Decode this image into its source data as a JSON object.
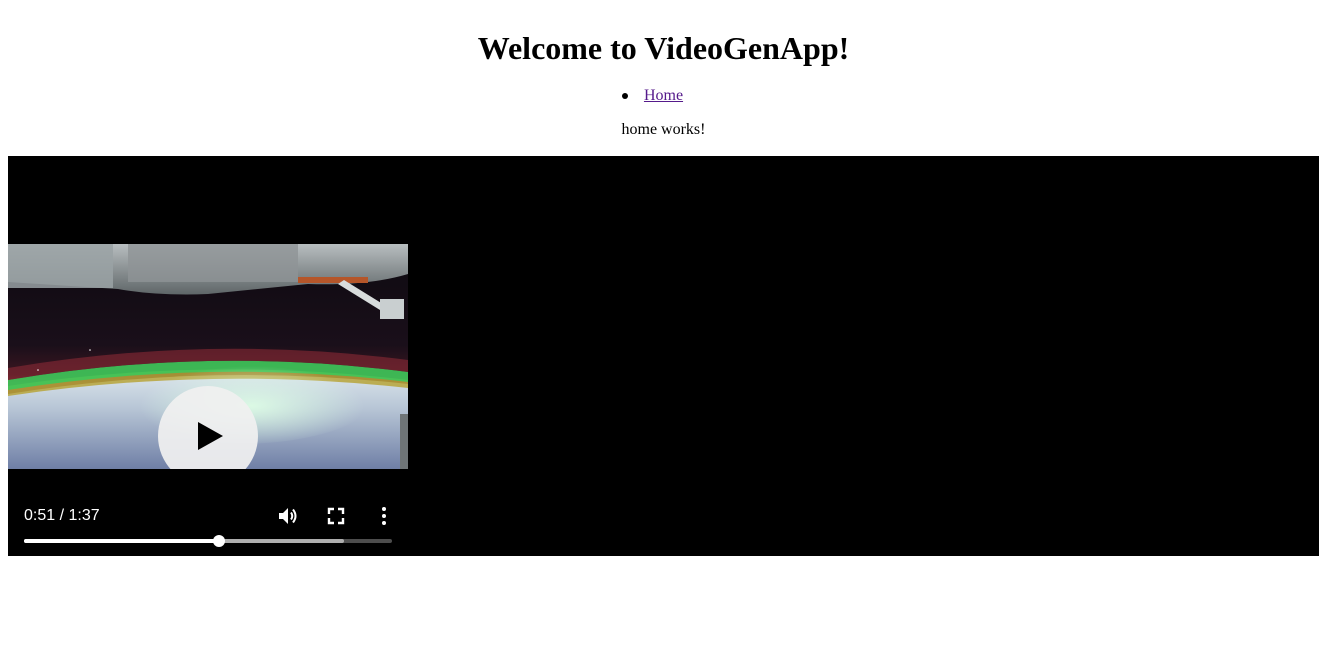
{
  "header": {
    "title": "Welcome to VideoGenApp!"
  },
  "nav": {
    "items": [
      {
        "label": "Home"
      }
    ]
  },
  "main": {
    "status_text": "home works!"
  },
  "video": {
    "current_time": "0:51",
    "duration": "1:37",
    "time_display": "0:51 / 1:37",
    "played_fraction": 0.53,
    "buffered_fraction": 0.87,
    "icons": {
      "play": "play-icon",
      "volume": "volume-icon",
      "fullscreen": "fullscreen-icon",
      "more": "more-options-icon"
    }
  },
  "colors": {
    "link": "#551a8b",
    "video_background": "#000000",
    "aurora": "#3ec85a"
  }
}
